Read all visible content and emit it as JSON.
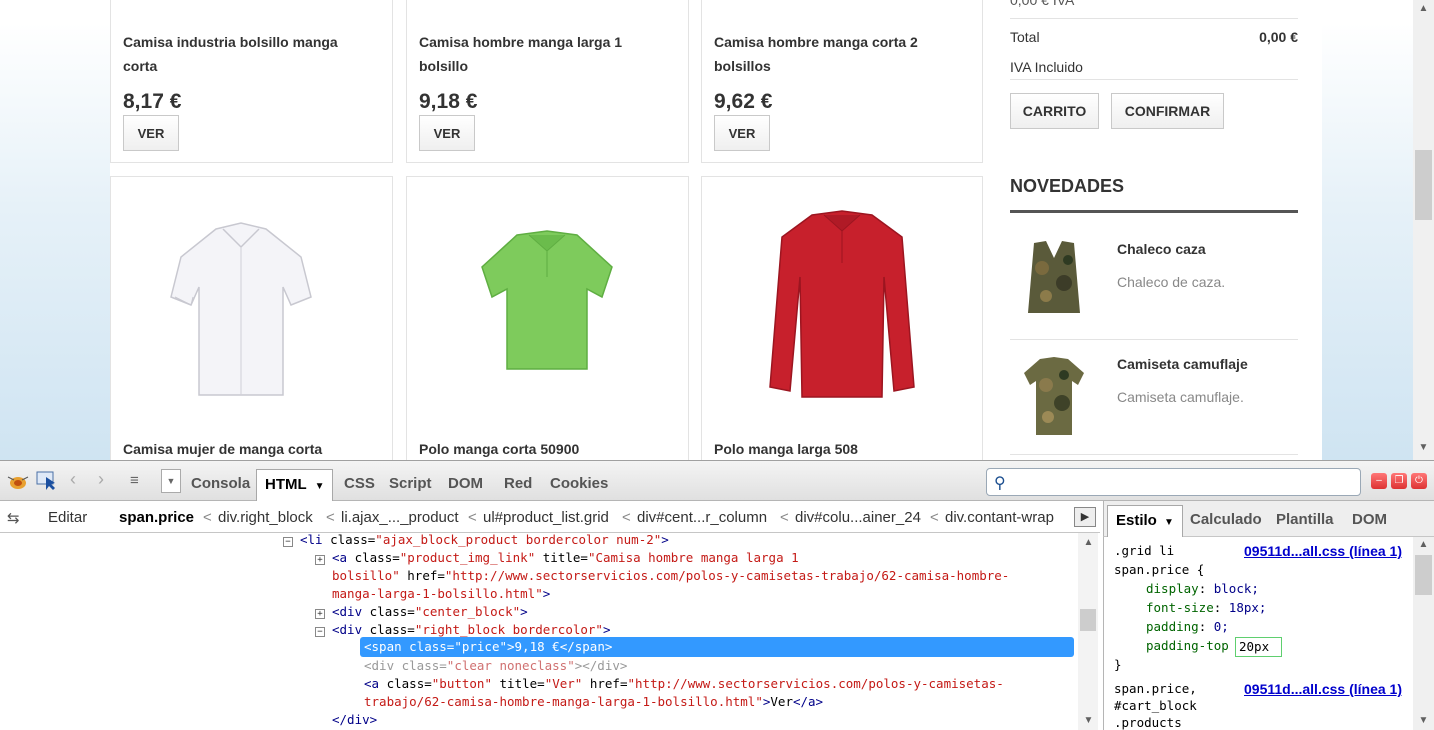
{
  "products_top": [
    {
      "title_l1": "Camisa industria bolsillo manga",
      "title_l2": "corta",
      "price": "8,17 €",
      "button": "VER"
    },
    {
      "title_l1": "Camisa hombre manga larga 1",
      "title_l2": "bolsillo",
      "price": "9,18 €",
      "button": "VER"
    },
    {
      "title_l1": "Camisa hombre manga corta 2",
      "title_l2": "bolsillos",
      "price": "9,62 €",
      "button": "VER"
    }
  ],
  "products_bottom": [
    {
      "title": "Camisa mujer de manga corta",
      "image": "white-shirt"
    },
    {
      "title": "Polo manga corta 50900",
      "image": "green-polo"
    },
    {
      "title": "Polo manga larga 508",
      "image": "red-long-polo"
    }
  ],
  "cart": {
    "clipped_top": "0,00 € IVA",
    "total_label": "Total",
    "total_value": "0,00 €",
    "iva_label": "IVA Incluido",
    "cart_button": "CARRITO",
    "confirm_button": "CONFIRMAR"
  },
  "novedades": {
    "title": "NOVEDADES",
    "items": [
      {
        "name": "Chaleco caza",
        "desc": "Chaleco de caza.",
        "image": "camo-vest"
      },
      {
        "name": "Camiseta camuflaje",
        "desc": "Camiseta camuflaje.",
        "image": "camo-tshirt"
      }
    ]
  },
  "firebug": {
    "tabs": [
      "Consola",
      "HTML",
      "CSS",
      "Script",
      "DOM",
      "Red",
      "Cookies"
    ],
    "active_tab": "HTML",
    "search_placeholder": "",
    "edit_label": "Editar",
    "breadcrumbs": [
      "span.price",
      "div.right_block",
      "li.ajax_..._product",
      "ul#product_list.grid",
      "div#cent...r_column",
      "div#colu...ainer_24",
      "div.contant-wrap"
    ],
    "side_tabs": [
      "Estilo",
      "Calculado",
      "Plantilla",
      "DOM"
    ],
    "active_side_tab": "Estilo",
    "html_lines": {
      "l1_tag": "li",
      "l1_attr": "class",
      "l1_val": "\"ajax_block_product bordercolor num-2\"",
      "l2_attr_class": "class",
      "l2_val_class": "\"product_img_link\"",
      "l2_attr_title": "title",
      "l2_val_title": "\"Camisa hombre manga larga 1",
      "l3_val_title_end": "bolsillo\"",
      "l3_attr_href": "href",
      "l3_val_href": "\"http://www.sectorservicios.com/polos-y-camisetas-trabajo/62-camisa-hombre-",
      "l4_val_href_end": "manga-larga-1-bolsillo.html\"",
      "l5_val": "\"center_block\"",
      "l6_val": "\"right_block bordercolor\"",
      "l7_val": "\"price\"",
      "l7_text": "9,18 €",
      "l8_val": "\"clear noneclass\"",
      "l9_val_class": "\"button\"",
      "l9_val_title": "\"Ver\"",
      "l9_val_href": "\"http://www.sectorservicios.com/polos-y-camisetas-",
      "l10_val_href_end": "trabajo/62-camisa-hombre-manga-larga-1-bolsillo.html\"",
      "l10_text": "Ver"
    },
    "style": {
      "rule1_selector_l1": ".grid li",
      "rule1_selector_l2": "span.price {",
      "rule1_source": "09511d...all.css (línea 1)",
      "props": [
        {
          "name": "display",
          "value": "block;"
        },
        {
          "name": "font-size",
          "value": "18px;"
        },
        {
          "name": "padding",
          "value": "0;"
        }
      ],
      "editing_prop": "padding-top",
      "editing_value": "20px",
      "rule1_close": "}",
      "rule2_selector_l1": "span.price,",
      "rule2_selector_l2": "#cart_block",
      "rule2_selector_l3": ".products",
      "rule2_source": "09511d...all.css (línea 1)"
    }
  }
}
